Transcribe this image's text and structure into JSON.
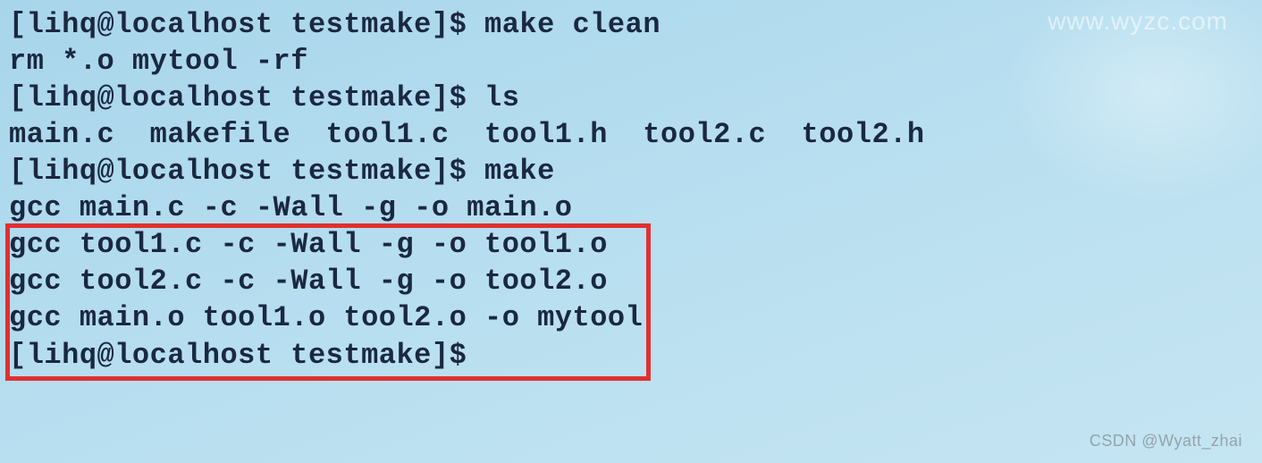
{
  "prompt": "[lihq@localhost testmake]$",
  "lines": {
    "cmd1": "make clean",
    "out1": "rm *.o mytool -rf",
    "cmd2": "ls",
    "out2": "main.c  makefile  tool1.c  tool1.h  tool2.c  tool2.h",
    "cmd3": "make",
    "out3_1": "gcc main.c -c -Wall -g -o main.o",
    "out3_2": "gcc tool1.c -c -Wall -g -o tool1.o",
    "out3_3": "gcc tool2.c -c -Wall -g -o tool2.o",
    "out3_4": "gcc main.o tool1.o tool2.o -o mytool"
  },
  "watermark_top": "www.wyzc.com",
  "watermark_bottom": "CSDN @Wyatt_zhai"
}
